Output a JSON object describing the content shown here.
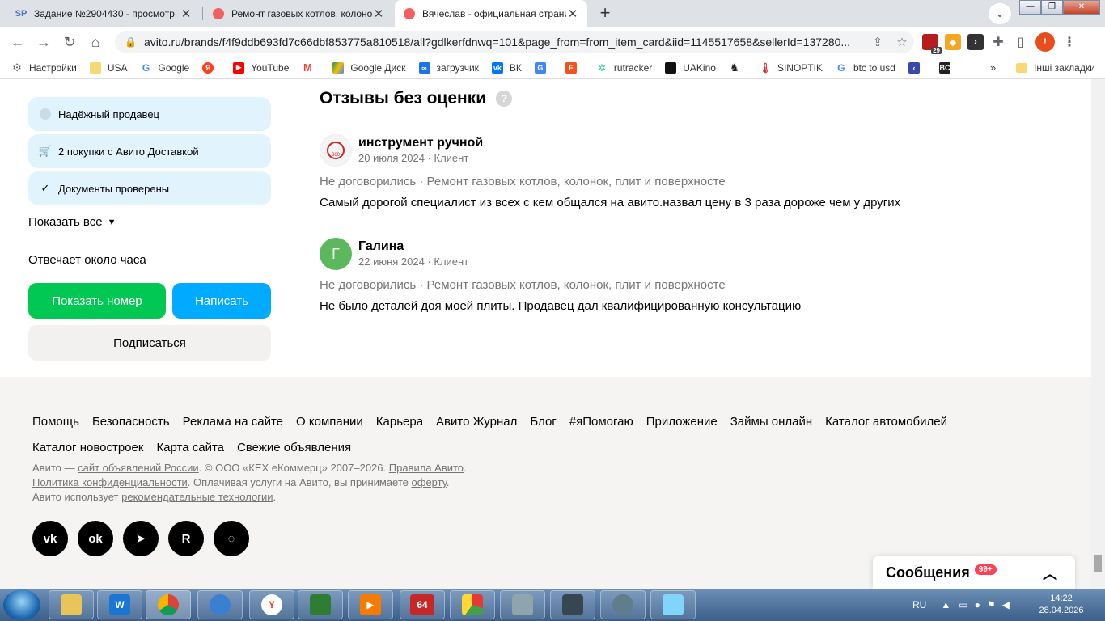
{
  "browser": {
    "tabs": [
      {
        "favicon": "SP",
        "title": "Задание №2904430 - просмотр"
      },
      {
        "favicon": "avito-icon",
        "title": "Ремонт газовых котлов, колоно"
      },
      {
        "favicon": "avito-icon",
        "title": "Вячеслав - официальная страни"
      }
    ],
    "url": "avito.ru/brands/f4f9ddb693fd7c66dbf853775a810518/all?gdlkerfdnwq=101&page_from=from_item_card&iid=1145517658&sellerId=137280...",
    "profile_initial": "!",
    "extension_badge": "29",
    "window_controls": {
      "minimize": "—",
      "restore": "❐",
      "close": "✕"
    }
  },
  "bookmarks": {
    "items": [
      "Настройки",
      "USA",
      "Google",
      "",
      "YouTube",
      "",
      "Google Диск",
      "загрузчик",
      "ВК",
      "",
      "",
      "rutracker",
      "UAKino",
      "",
      "SINOPTIK",
      "btc to usd",
      "",
      ""
    ],
    "more": "»",
    "other": "Інші закладки"
  },
  "seller": {
    "badges": [
      "Надёжный продавец",
      "2 покупки с Авито Доставкой",
      "Документы проверены"
    ],
    "show_all": "Показать все",
    "reply_time": "Отвечает около часа",
    "show_phone": "Показать номер",
    "write": "Написать",
    "subscribe": "Подписаться"
  },
  "reviews": {
    "title": "Отзывы без оценки",
    "help": "?",
    "items": [
      {
        "name": "инструмент ручной",
        "avatar_letter": "",
        "avatar_text": "360",
        "meta": "20 июля 2024 · Клиент",
        "deal": "Не договорились · Ремонт газовых котлов, колонок, плит и поверхносте",
        "text": "Самый дорогой специалист из всех с кем общался на авито.назвал цену в 3 раза дороже чем у других"
      },
      {
        "name": "Галина",
        "avatar_letter": "Г",
        "meta": "22 июня 2024 · Клиент",
        "deal": "Не договорились · Ремонт газовых котлов, колонок, плит и поверхносте",
        "text": "Не было деталей доя моей плиты. Продавец дал квалифицированную консультацию"
      }
    ]
  },
  "footer": {
    "links": [
      "Помощь",
      "Безопасность",
      "Реклама на сайте",
      "О компании",
      "Карьера",
      "Авито Журнал",
      "Блог",
      "#яПомогаю",
      "Приложение",
      "Займы онлайн",
      "Каталог автомобилей",
      "Каталог новостроек",
      "Карта сайта",
      "Свежие объявления"
    ],
    "legal": {
      "l1a": "Авито — ",
      "l1b": "сайт объявлений России",
      "l1c": ". © ООО «КЕХ еКоммерц» 2007–2026. ",
      "l1d": "Правила Авито",
      "l1e": ".",
      "l2a": "Политика конфиденциальности",
      "l2b": ". Оплачивая услуги на Авито, вы принимаете ",
      "l2c": "оферту",
      "l2d": ".",
      "l3a": "Авито использует ",
      "l3b": "рекомендательные технологии",
      "l3c": "."
    },
    "social": [
      "vk-icon",
      "odnoklassniki-icon",
      "telegram-icon",
      "rutube-icon",
      "dzen-icon"
    ]
  },
  "messages": {
    "label": "Сообщения",
    "count": "99+"
  },
  "taskbar": {
    "lang": "RU",
    "time": "14:22",
    "date": "28.04.2026",
    "app_64": "64"
  }
}
